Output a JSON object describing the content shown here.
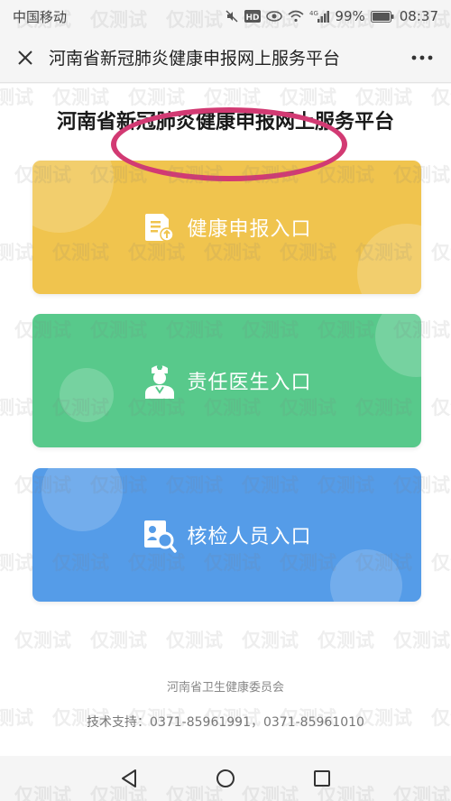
{
  "status_bar": {
    "carrier": "中国移动",
    "network_label": "4G",
    "battery": "99%",
    "time": "08:37"
  },
  "title_bar": {
    "title": "河南省新冠肺炎健康申报网上服务平台"
  },
  "page": {
    "heading": "河南省新冠肺炎健康申报网上服务平台",
    "entries": [
      {
        "label": "健康申报入口",
        "color": "#f0c44e",
        "icon": "health-report-icon"
      },
      {
        "label": "责任医生入口",
        "color": "#58c98b",
        "icon": "doctor-icon"
      },
      {
        "label": "核检人员入口",
        "color": "#559ce8",
        "icon": "inspection-icon"
      }
    ],
    "highlight_color": "#d23a73",
    "footer_org": "河南省卫生健康委员会",
    "footer_support": "技术支持：0371-85961991，0371-85961010"
  },
  "watermark": {
    "text": "仅测试"
  },
  "nav_bar": {
    "icons": [
      "back-icon",
      "home-icon",
      "recents-icon"
    ]
  }
}
